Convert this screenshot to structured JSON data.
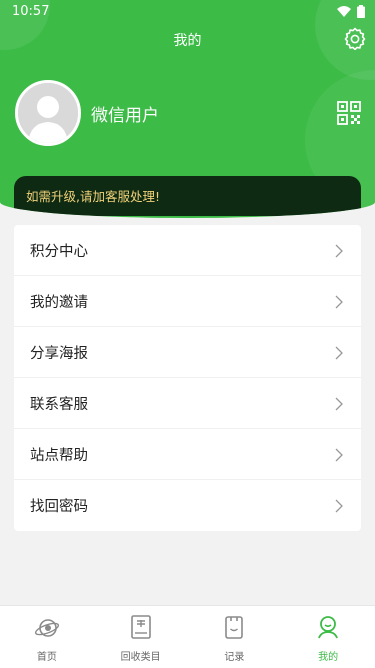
{
  "status": {
    "time": "10:57"
  },
  "header": {
    "title": "我的",
    "username": "微信用户"
  },
  "notice": "如需升级,请加客服处理!",
  "menu": [
    {
      "label": "积分中心"
    },
    {
      "label": "我的邀请"
    },
    {
      "label": "分享海报"
    },
    {
      "label": "联系客服"
    },
    {
      "label": "站点帮助"
    },
    {
      "label": "找回密码"
    }
  ],
  "tabs": [
    {
      "label": "首页",
      "icon": "home-icon"
    },
    {
      "label": "回收类目",
      "icon": "category-icon"
    },
    {
      "label": "记录",
      "icon": "record-icon"
    },
    {
      "label": "我的",
      "icon": "profile-icon",
      "active": true
    }
  ],
  "colors": {
    "primary": "#3cbb47",
    "notice_bg": "#0e2a12",
    "notice_text": "#f1d27a"
  }
}
